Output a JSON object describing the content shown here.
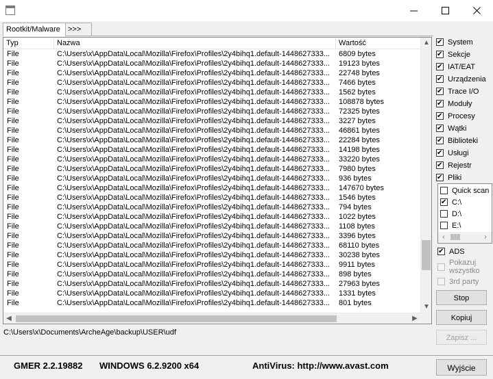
{
  "window": {
    "minimize_glyph": "—",
    "maximize_glyph": "☐",
    "close_glyph": "✕"
  },
  "tabs": [
    {
      "label": "Rootkit/Malware"
    },
    {
      "label": ">>>"
    }
  ],
  "table": {
    "columns": [
      "Typ",
      "Nazwa",
      "Wartość"
    ],
    "rows": [
      [
        "File",
        "C:\\Users\\x\\AppData\\Local\\Mozilla\\Firefox\\Profiles\\2y4bihq1.default-1448627333...",
        "6809 bytes"
      ],
      [
        "File",
        "C:\\Users\\x\\AppData\\Local\\Mozilla\\Firefox\\Profiles\\2y4bihq1.default-1448627333...",
        "19123 bytes"
      ],
      [
        "File",
        "C:\\Users\\x\\AppData\\Local\\Mozilla\\Firefox\\Profiles\\2y4bihq1.default-1448627333...",
        "22748 bytes"
      ],
      [
        "File",
        "C:\\Users\\x\\AppData\\Local\\Mozilla\\Firefox\\Profiles\\2y4bihq1.default-1448627333...",
        "7466 bytes"
      ],
      [
        "File",
        "C:\\Users\\x\\AppData\\Local\\Mozilla\\Firefox\\Profiles\\2y4bihq1.default-1448627333...",
        "1562 bytes"
      ],
      [
        "File",
        "C:\\Users\\x\\AppData\\Local\\Mozilla\\Firefox\\Profiles\\2y4bihq1.default-1448627333...",
        "108878 bytes"
      ],
      [
        "File",
        "C:\\Users\\x\\AppData\\Local\\Mozilla\\Firefox\\Profiles\\2y4bihq1.default-1448627333...",
        "72325 bytes"
      ],
      [
        "File",
        "C:\\Users\\x\\AppData\\Local\\Mozilla\\Firefox\\Profiles\\2y4bihq1.default-1448627333...",
        "3227 bytes"
      ],
      [
        "File",
        "C:\\Users\\x\\AppData\\Local\\Mozilla\\Firefox\\Profiles\\2y4bihq1.default-1448627333...",
        "46861 bytes"
      ],
      [
        "File",
        "C:\\Users\\x\\AppData\\Local\\Mozilla\\Firefox\\Profiles\\2y4bihq1.default-1448627333...",
        "22284 bytes"
      ],
      [
        "File",
        "C:\\Users\\x\\AppData\\Local\\Mozilla\\Firefox\\Profiles\\2y4bihq1.default-1448627333...",
        "14198 bytes"
      ],
      [
        "File",
        "C:\\Users\\x\\AppData\\Local\\Mozilla\\Firefox\\Profiles\\2y4bihq1.default-1448627333...",
        "33220 bytes"
      ],
      [
        "File",
        "C:\\Users\\x\\AppData\\Local\\Mozilla\\Firefox\\Profiles\\2y4bihq1.default-1448627333...",
        "7980 bytes"
      ],
      [
        "File",
        "C:\\Users\\x\\AppData\\Local\\Mozilla\\Firefox\\Profiles\\2y4bihq1.default-1448627333...",
        "936 bytes"
      ],
      [
        "File",
        "C:\\Users\\x\\AppData\\Local\\Mozilla\\Firefox\\Profiles\\2y4bihq1.default-1448627333...",
        "147670 bytes"
      ],
      [
        "File",
        "C:\\Users\\x\\AppData\\Local\\Mozilla\\Firefox\\Profiles\\2y4bihq1.default-1448627333...",
        "1546 bytes"
      ],
      [
        "File",
        "C:\\Users\\x\\AppData\\Local\\Mozilla\\Firefox\\Profiles\\2y4bihq1.default-1448627333...",
        "794 bytes"
      ],
      [
        "File",
        "C:\\Users\\x\\AppData\\Local\\Mozilla\\Firefox\\Profiles\\2y4bihq1.default-1448627333...",
        "1022 bytes"
      ],
      [
        "File",
        "C:\\Users\\x\\AppData\\Local\\Mozilla\\Firefox\\Profiles\\2y4bihq1.default-1448627333...",
        "1108 bytes"
      ],
      [
        "File",
        "C:\\Users\\x\\AppData\\Local\\Mozilla\\Firefox\\Profiles\\2y4bihq1.default-1448627333...",
        "3396 bytes"
      ],
      [
        "File",
        "C:\\Users\\x\\AppData\\Local\\Mozilla\\Firefox\\Profiles\\2y4bihq1.default-1448627333...",
        "68110 bytes"
      ],
      [
        "File",
        "C:\\Users\\x\\AppData\\Local\\Mozilla\\Firefox\\Profiles\\2y4bihq1.default-1448627333...",
        "30238 bytes"
      ],
      [
        "File",
        "C:\\Users\\x\\AppData\\Local\\Mozilla\\Firefox\\Profiles\\2y4bihq1.default-1448627333...",
        "9911 bytes"
      ],
      [
        "File",
        "C:\\Users\\x\\AppData\\Local\\Mozilla\\Firefox\\Profiles\\2y4bihq1.default-1448627333...",
        "898 bytes"
      ],
      [
        "File",
        "C:\\Users\\x\\AppData\\Local\\Mozilla\\Firefox\\Profiles\\2y4bihq1.default-1448627333...",
        "27963 bytes"
      ],
      [
        "File",
        "C:\\Users\\x\\AppData\\Local\\Mozilla\\Firefox\\Profiles\\2y4bihq1.default-1448627333...",
        "1331 bytes"
      ],
      [
        "File",
        "C:\\Users\\x\\AppData\\Local\\Mozilla\\Firefox\\Profiles\\2y4bihq1.default-1448627333...",
        "801 bytes"
      ]
    ]
  },
  "options": [
    {
      "label": "System",
      "checked": true
    },
    {
      "label": "Sekcje",
      "checked": true
    },
    {
      "label": "IAT/EAT",
      "checked": true
    },
    {
      "label": "Urządzenia",
      "checked": true
    },
    {
      "label": "Trace I/O",
      "checked": true
    },
    {
      "label": "Moduły",
      "checked": true
    },
    {
      "label": "Procesy",
      "checked": true
    },
    {
      "label": "Wątki",
      "checked": true
    },
    {
      "label": "Biblioteki",
      "checked": true
    },
    {
      "label": "Usługi",
      "checked": true
    },
    {
      "label": "Rejestr",
      "checked": true
    },
    {
      "label": "Pliki",
      "checked": true
    }
  ],
  "drives": [
    {
      "label": "Quick scan",
      "checked": false
    },
    {
      "label": "C:\\",
      "checked": true
    },
    {
      "label": "D:\\",
      "checked": false
    },
    {
      "label": "E:\\",
      "checked": false
    }
  ],
  "extra_options": {
    "ads": {
      "label": "ADS",
      "checked": true
    },
    "show_all": {
      "label_line1": "Pokazuj",
      "label_line2": "wszystko",
      "checked": false
    },
    "third_party": {
      "label": "3rd party",
      "checked": false
    }
  },
  "buttons": {
    "stop": "Stop",
    "copy": "Kopiuj",
    "save": "Zapisz ...",
    "exit": "Wyjście"
  },
  "current_path": "C:\\Users\\x\\Documents\\ArcheAge\\backup\\USER\\udf",
  "status": {
    "version": "GMER 2.2.19882",
    "os": "WINDOWS 6.2.9200  x64",
    "antivirus": "AntiVirus: http://www.avast.com"
  },
  "scroll": {
    "vertical_position": 0.86,
    "horizontal_fraction": 0.82
  }
}
